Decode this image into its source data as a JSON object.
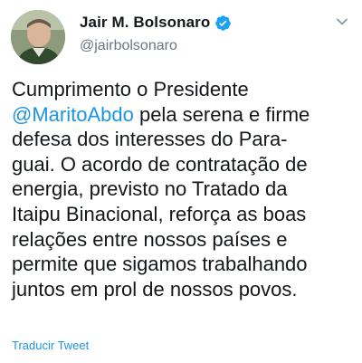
{
  "author": {
    "display_name": "Jair M. Bolsonaro",
    "handle": "@jairbolsonaro",
    "verified": true
  },
  "tweet": {
    "lines": [
      {
        "segments": [
          {
            "text": "Cumprimento o Presidente",
            "type": "text"
          }
        ]
      },
      {
        "segments": [
          {
            "text": "@MaritoAbdo",
            "type": "mention"
          },
          {
            "text": " pela serena e firme",
            "type": "text"
          }
        ]
      },
      {
        "segments": [
          {
            "text": "defesa dos interesses do Para-",
            "type": "text"
          }
        ]
      },
      {
        "segments": [
          {
            "text": "guai. O acordo de contratação de",
            "type": "text"
          }
        ]
      },
      {
        "segments": [
          {
            "text": "energia, previsto no Tratado da",
            "type": "text"
          }
        ]
      },
      {
        "segments": [
          {
            "text": "Itaipu Binacional, reforça as boas",
            "type": "text"
          }
        ]
      },
      {
        "segments": [
          {
            "text": "relações entre nossos países e",
            "type": "text"
          }
        ]
      },
      {
        "segments": [
          {
            "text": "permite que sigamos trabalhando",
            "type": "text"
          }
        ]
      },
      {
        "segments": [
          {
            "text": "juntos em prol de nossos povos.",
            "type": "text"
          }
        ]
      }
    ]
  },
  "actions": {
    "translate_label": "Traducir Tweet"
  },
  "icons": {
    "verified": "verified-badge-icon",
    "menu": "chevron-down-icon"
  },
  "colors": {
    "link": "#1b95e0",
    "verified": "#1da1f2",
    "text": "#14171a",
    "muted": "#657786"
  }
}
